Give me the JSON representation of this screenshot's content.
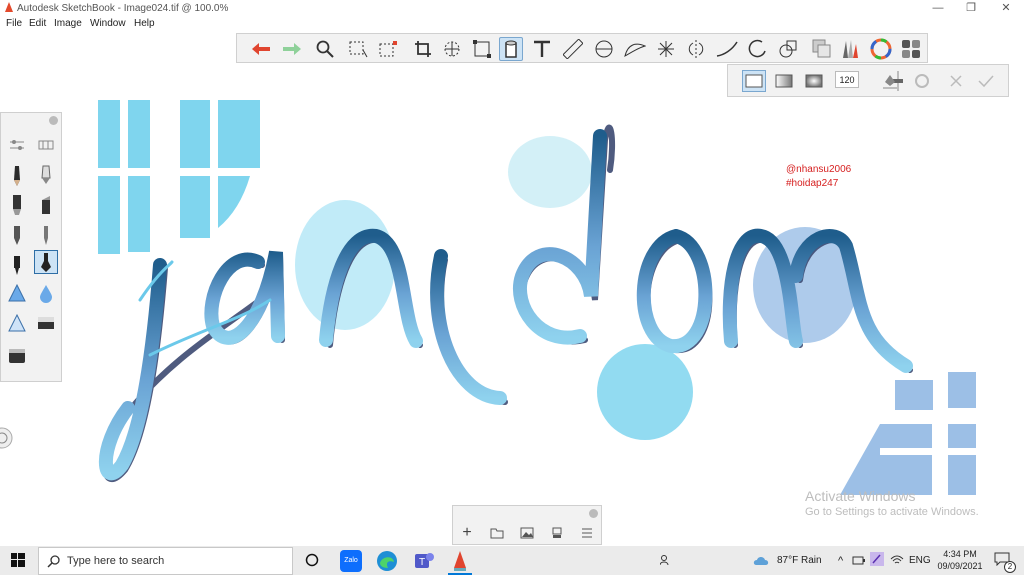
{
  "window": {
    "title": "Autodesk SketchBook - Image024.tif @ 100.0%",
    "controls": [
      "—",
      "❐",
      "✕"
    ]
  },
  "menu": [
    "File",
    "Edit",
    "Image",
    "Window",
    "Help"
  ],
  "toolbar": {
    "tools": [
      "undo",
      "redo",
      "zoom",
      "select",
      "crop-select",
      "crop",
      "move",
      "distort",
      "fill",
      "text",
      "ruler",
      "ellipse",
      "french-curve",
      "perspective",
      "symmetry",
      "stroke",
      "shape",
      "predictive",
      "copy",
      "brush",
      "color-wheel",
      "palette"
    ],
    "active_tool": "fill"
  },
  "subtoolbar": {
    "brush_size": "120"
  },
  "canvas": {
    "artwork_text": "random",
    "handles": [
      "@nhansu2006",
      "#hoidap247"
    ],
    "colors": {
      "dark_blue": "#1f5d8c",
      "light_blue": "#79d0ec",
      "pale_blue": "#9cbfe6",
      "shadow": "#3d4a72"
    }
  },
  "brush_panel": {
    "brushes": [
      "pencil",
      "airbrush",
      "marker",
      "chisel",
      "ink-pen",
      "fine-pen",
      "technical-pen",
      "calligraphy-pen",
      "triangle-brush",
      "drop-brush",
      "triangle-outline",
      "eraser",
      "bucket"
    ],
    "active_brush": "calligraphy-pen"
  },
  "layer_bar": {
    "buttons": [
      "+",
      "folder",
      "image",
      "merge",
      "menu"
    ]
  },
  "watermark": {
    "line1": "Activate Windows",
    "line2": "Go to Settings to activate Windows."
  },
  "taskbar": {
    "search_placeholder": "Type here to search",
    "apps": [
      "cortana",
      "zalo",
      "edge",
      "teams",
      "sketchbook"
    ],
    "weather": "87°F  Rain",
    "lang": "ENG",
    "time": "4:34 PM",
    "date": "09/09/2021",
    "notifications": "2"
  }
}
